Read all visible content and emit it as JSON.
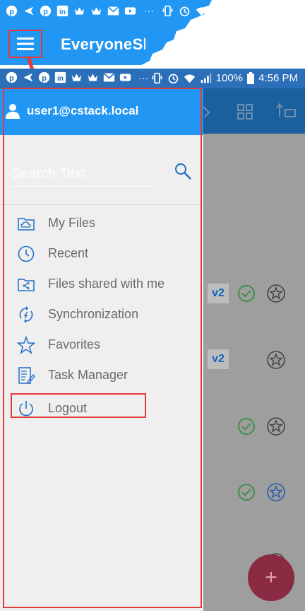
{
  "top_screenshot": {
    "app_title": "EveryoneSh",
    "status_icons": [
      "pinterest-icon",
      "send-icon",
      "pinterest-icon",
      "linkedin-icon",
      "crown-icon",
      "crown-icon",
      "gmail-icon",
      "youtube-icon",
      "more-icon",
      "vibrate-icon",
      "alarm-icon",
      "wifi-icon"
    ],
    "more": "···"
  },
  "status_bar": {
    "battery": "100%",
    "time": "4:56 PM",
    "more": "···"
  },
  "drawer": {
    "user": "user1@cstack.local",
    "search_placeholder": "Search Text",
    "menu": [
      {
        "label": "My Files",
        "icon": "cloud-folder-icon"
      },
      {
        "label": "Recent",
        "icon": "clock-icon"
      },
      {
        "label": "Files shared with me",
        "icon": "shared-folder-icon"
      },
      {
        "label": "Synchronization",
        "icon": "sync-icon"
      },
      {
        "label": "Favorites",
        "icon": "star-icon"
      },
      {
        "label": "Task Manager",
        "icon": "task-icon"
      },
      {
        "label": "Logout",
        "icon": "power-icon"
      }
    ]
  },
  "background": {
    "version_badges": [
      "v2",
      "v2"
    ],
    "fab": "+"
  },
  "colors": {
    "accent": "#2196f3",
    "annotation": "#e53935"
  }
}
